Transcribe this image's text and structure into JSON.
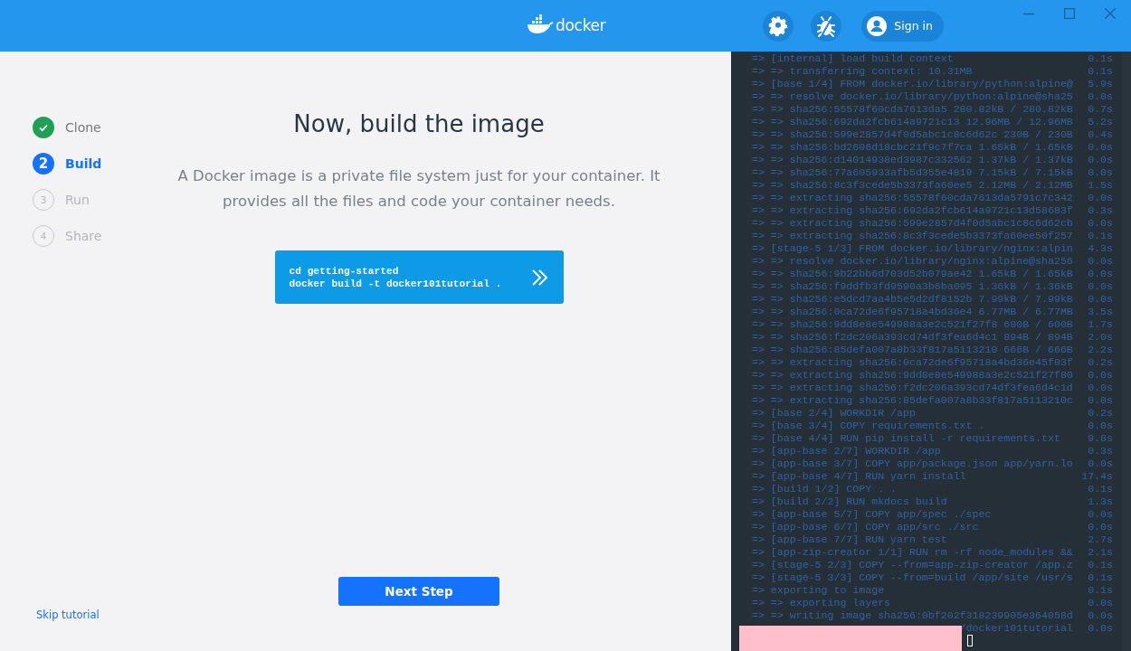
{
  "top_bar": {
    "logo": "docker",
    "sign_in": "Sign in"
  },
  "steps": [
    {
      "label": "Clone",
      "completed": true,
      "selected": false
    },
    {
      "label": "Build",
      "number": "2",
      "completed": false,
      "selected": true
    },
    {
      "label": "Run",
      "number": "3",
      "completed": false,
      "selected": false
    },
    {
      "label": "Share",
      "number": "4",
      "completed": false,
      "selected": false
    }
  ],
  "skip_link": "Skip tutorial",
  "heading": "Now, build the image",
  "description": "A Docker image is a private file system just for your container. It provides all the files and code your container needs.",
  "command": [
    "cd getting-started",
    "docker build -t docker101tutorial ."
  ],
  "next_button": "Next Step",
  "terminal": {
    "redacted": true,
    "lines": [
      {
        "text": "=> [internal] load build context",
        "time": "0.1s"
      },
      {
        "text": "=> => transferring context: 10.31MB",
        "time": "0.1s"
      },
      {
        "text": "=> [base 1/4] FROM docker.io/library/python:alpine@",
        "time": "5.9s"
      },
      {
        "text": "=> => resolve docker.io/library/python:alpine@sha25",
        "time": "0.0s"
      },
      {
        "text": "=> => sha256:55578f60cda7613da5 280.82kB / 280.82kB",
        "time": "0.7s"
      },
      {
        "text": "=> => sha256:692da2fcb614a9721c13 12.96MB / 12.96MB",
        "time": "5.2s"
      },
      {
        "text": "=> => sha256:599e2857d4f0d5abc1c8c6d62c 230B / 230B",
        "time": "0.4s"
      },
      {
        "text": "=> => sha256:bd2606d18cbc21f9c7f7ca 1.65kB / 1.65kB",
        "time": "0.0s"
      },
      {
        "text": "=> => sha256:d14014938ed3987c332562 1.37kB / 1.37kB",
        "time": "0.0s"
      },
      {
        "text": "=> => sha256:77a605933afb5d355e4819 7.15kB / 7.15kB",
        "time": "0.0s"
      },
      {
        "text": "=> => sha256:8c3f3cede5b3373fa60ee5 2.12MB / 2.12MB",
        "time": "1.5s"
      },
      {
        "text": "=> => extracting sha256:55578f60cda7613da5791c7c342",
        "time": "0.0s"
      },
      {
        "text": "=> => extracting sha256:692da2fcb614a9721c13d58683f",
        "time": "0.3s"
      },
      {
        "text": "=> => extracting sha256:599e2857d4f0d5abc1c8c6d62cb",
        "time": "0.0s"
      },
      {
        "text": "=> => extracting sha256:8c3f3cede5b3373fa60ee50f257",
        "time": "0.1s"
      },
      {
        "text": "=> [stage-5 1/3] FROM docker.io/library/nginx:alpin",
        "time": "4.3s"
      },
      {
        "text": "=> => resolve docker.io/library/nginx:alpine@sha256",
        "time": "0.0s"
      },
      {
        "text": "=> => sha256:9b22bb6d703d52b079ae42 1.65kB / 1.65kB",
        "time": "0.0s"
      },
      {
        "text": "=> => sha256:f9ddfb3fd9590a3b6ba095 1.36kB / 1.36kB",
        "time": "0.0s"
      },
      {
        "text": "=> => sha256:e5dcd7aa4b5e5d2df8152b 7.99kB / 7.99kB",
        "time": "0.0s"
      },
      {
        "text": "=> => sha256:0ca72de6f95718a4bd36e4 6.77MB / 6.77MB",
        "time": "3.5s"
      },
      {
        "text": "=> => sha256:9dd8e8e549988a3e2c521f27f8 600B / 600B",
        "time": "1.7s"
      },
      {
        "text": "=> => sha256:f2dc206a393cd74df3fea6d4c1 894B / 894B",
        "time": "2.0s"
      },
      {
        "text": "=> => sha256:85defa007a8b33f817a5113210 666B / 666B",
        "time": "2.2s"
      },
      {
        "text": "=> => extracting sha256:0ca72de6f95718a4bd36e45f03f",
        "time": "0.2s"
      },
      {
        "text": "=> => extracting sha256:9dd8e8e549988a3e2c521f27f80",
        "time": "0.0s"
      },
      {
        "text": "=> => extracting sha256:f2dc206a393cd74df3fea6d4c1d",
        "time": "0.0s"
      },
      {
        "text": "=> => extracting sha256:85defa007a8b33f817a5113210c",
        "time": "0.0s"
      },
      {
        "text": "=> [base 2/4] WORKDIR /app",
        "time": "0.2s"
      },
      {
        "text": "=> [base 3/4] COPY requirements.txt .",
        "time": "0.0s"
      },
      {
        "text": "=> [base 4/4] RUN pip install -r requirements.txt",
        "time": "9.8s"
      },
      {
        "text": "=> [app-base 2/7] WORKDIR /app",
        "time": "0.3s"
      },
      {
        "text": "=> [app-base 3/7] COPY app/package.json app/yarn.lo",
        "time": "0.0s"
      },
      {
        "text": "=> [app-base 4/7] RUN yarn install",
        "time": "17.4s"
      },
      {
        "text": "=> [build 1/2] COPY . .",
        "time": "0.1s"
      },
      {
        "text": "=> [build 2/2] RUN mkdocs build",
        "time": "1.3s"
      },
      {
        "text": "=> [app-base 5/7] COPY app/spec ./spec",
        "time": "0.0s"
      },
      {
        "text": "=> [app-base 6/7] COPY app/src ./src",
        "time": "0.0s"
      },
      {
        "text": "=> [app-base 7/7] RUN yarn test",
        "time": "2.7s"
      },
      {
        "text": "=> [app-zip-creator 1/1] RUN rm -rf node_modules &&",
        "time": "2.1s"
      },
      {
        "text": "=> [stage-5 2/3] COPY --from=app-zip-creator /app.z",
        "time": "0.1s"
      },
      {
        "text": "=> [stage-5 3/3] COPY --from=build /app/site /usr/s",
        "time": "0.1s"
      },
      {
        "text": "=> exporting to image",
        "time": "0.1s"
      },
      {
        "text": "=> => exporting layers",
        "time": "0.0s"
      },
      {
        "text": "=> => writing image sha256:0bf202f318239905e364058d",
        "time": "0.0s"
      },
      {
        "text": "/docker101tutorial",
        "time": "0.0s",
        "covered": true
      }
    ]
  }
}
